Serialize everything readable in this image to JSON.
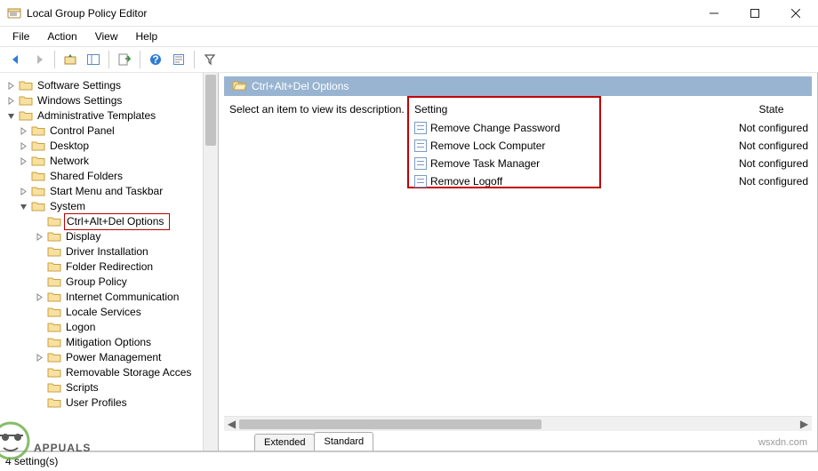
{
  "window": {
    "title": "Local Group Policy Editor"
  },
  "menu": {
    "file": "File",
    "action": "Action",
    "view": "View",
    "help": "Help"
  },
  "tree": {
    "root0": "Software Settings",
    "root1": "Windows Settings",
    "root2": "Administrative Templates",
    "at": {
      "control_panel": "Control Panel",
      "desktop": "Desktop",
      "network": "Network",
      "shared_folders": "Shared Folders",
      "start_menu": "Start Menu and Taskbar",
      "system": "System",
      "sys": {
        "ctrl_alt_del": "Ctrl+Alt+Del Options",
        "display": "Display",
        "driver_install": "Driver Installation",
        "folder_redir": "Folder Redirection",
        "group_policy": "Group Policy",
        "internet_comm": "Internet Communication",
        "locale": "Locale Services",
        "logon": "Logon",
        "mitigation": "Mitigation Options",
        "power": "Power Management",
        "removable": "Removable Storage Acces",
        "scripts": "Scripts",
        "user_profiles": "User Profiles"
      }
    }
  },
  "content": {
    "header": "Ctrl+Alt+Del Options",
    "desc": "Select an item to view its description.",
    "columns": {
      "setting": "Setting",
      "state": "State"
    },
    "rows": [
      {
        "setting": "Remove Change Password",
        "state": "Not configured"
      },
      {
        "setting": "Remove Lock Computer",
        "state": "Not configured"
      },
      {
        "setting": "Remove Task Manager",
        "state": "Not configured"
      },
      {
        "setting": "Remove Logoff",
        "state": "Not configured"
      }
    ]
  },
  "tabs": {
    "extended": "Extended",
    "standard": "Standard"
  },
  "status": "4 setting(s)",
  "watermark": "wsxdn.com",
  "brand": "APPUALS"
}
